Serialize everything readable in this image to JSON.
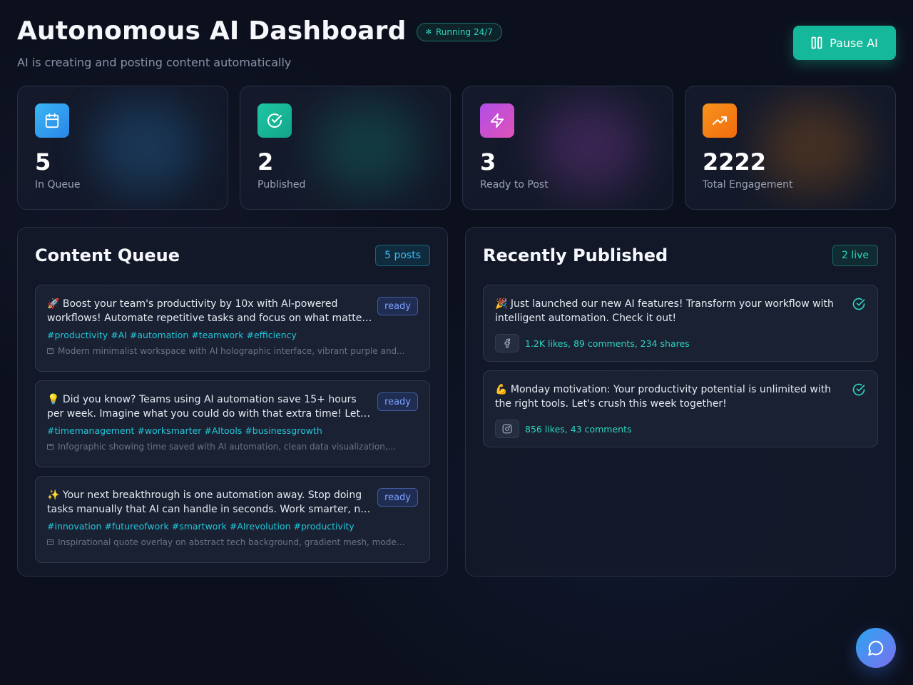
{
  "header": {
    "title": "Autonomous AI Dashboard",
    "status_badge": "Running 24/7",
    "subtitle": "AI is creating and posting content automatically",
    "pause_label": "Pause AI"
  },
  "stats": [
    {
      "value": "5",
      "label": "In Queue",
      "icon": "calendar-icon",
      "color": "#2f9ff0"
    },
    {
      "value": "2",
      "label": "Published",
      "icon": "check-circle-icon",
      "color": "#16b39a"
    },
    {
      "value": "3",
      "label": "Ready to Post",
      "icon": "lightning-icon",
      "color": "#c04fe0"
    },
    {
      "value": "2222",
      "label": "Total Engagement",
      "icon": "trending-up-icon",
      "color": "#f5830f"
    }
  ],
  "queue": {
    "title": "Content Queue",
    "count_badge": "5 posts",
    "items": [
      {
        "text": "🚀 Boost your team's productivity by 10x with AI-powered workflows! Automate repetitive tasks and focus on what matters most.",
        "status": "ready",
        "tags": [
          "#productivity",
          "#AI",
          "#automation",
          "#teamwork",
          "#efficiency"
        ],
        "image_desc": "Modern minimalist workspace with AI holographic interface, vibrant purple and..."
      },
      {
        "text": "💡 Did you know? Teams using AI automation save 15+ hours per week. Imagine what you could do with that extra time! Let's talk.",
        "status": "ready",
        "tags": [
          "#timemanagement",
          "#worksmarter",
          "#AItools",
          "#businessgrowth"
        ],
        "image_desc": "Infographic showing time saved with AI automation, clean data visualization,..."
      },
      {
        "text": "✨ Your next breakthrough is one automation away. Stop doing tasks manually that AI can handle in seconds. Work smarter, not harder.",
        "status": "ready",
        "tags": [
          "#innovation",
          "#futureofwork",
          "#smartwork",
          "#AIrevolution",
          "#productivity"
        ],
        "image_desc": "Inspirational quote overlay on abstract tech background, gradient mesh, modern..."
      }
    ]
  },
  "published": {
    "title": "Recently Published",
    "count_badge": "2 live",
    "items": [
      {
        "text": "🎉 Just launched our new AI features! Transform your workflow with intelligent automation. Check it out!",
        "platform": "facebook-icon",
        "engagement": "1.2K likes, 89 comments, 234 shares"
      },
      {
        "text": "💪 Monday motivation: Your productivity potential is unlimited with the right tools. Let's crush this week together!",
        "platform": "instagram-icon",
        "engagement": "856 likes, 43 comments"
      }
    ]
  },
  "colors": {
    "accent_teal": "#15b89b",
    "accent_cyan": "#22c6d8",
    "ready_blue": "#7ba0ff",
    "background": "#0c101d"
  }
}
